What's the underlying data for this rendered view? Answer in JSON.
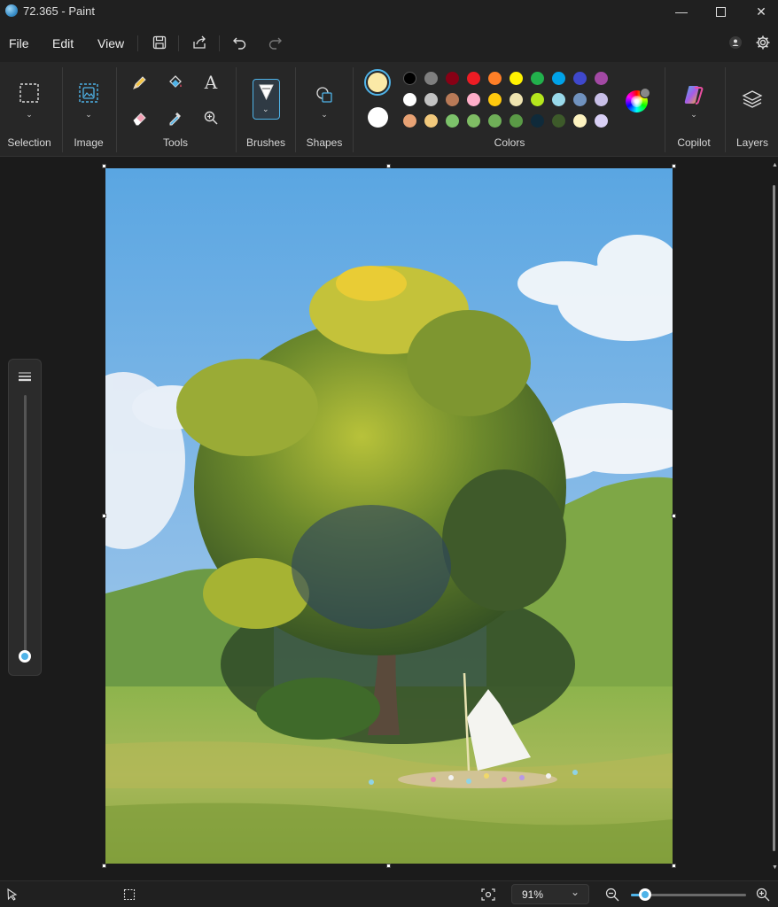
{
  "window": {
    "title": "72.365 - Paint"
  },
  "menu": {
    "file": "File",
    "edit": "Edit",
    "view": "View"
  },
  "ribbon": {
    "groups": {
      "selection": "Selection",
      "image": "Image",
      "tools": "Tools",
      "brushes": "Brushes",
      "shapes": "Shapes",
      "colors": "Colors",
      "copilot": "Copilot",
      "layers": "Layers"
    },
    "text_tool_glyph": "A"
  },
  "colors": {
    "primary": "#fbe9a7",
    "secondary": "#ffffff",
    "palette": [
      [
        "#000000",
        "#7f7f7f",
        "#880015",
        "#ed1c24",
        "#ff7f27",
        "#fff200",
        "#22b14c",
        "#00a2e8",
        "#3f48cc",
        "#a349a4"
      ],
      [
        "#ffffff",
        "#c3c3c3",
        "#b97a57",
        "#ffaec9",
        "#ffc90e",
        "#efe4b0",
        "#b5e61d",
        "#99d9ea",
        "#7092be",
        "#c8bfe7"
      ],
      [
        "#e8a274",
        "#f2c97c",
        "#7cc26a",
        "#7fbd64",
        "#6faf58",
        "#5a9a46",
        "#0f2a3a",
        "#3d5a2a",
        "#fdf3c0",
        "#d9d0f5"
      ]
    ]
  },
  "status": {
    "zoom": "91%",
    "zoom_slider_fraction": 0.12,
    "brush_size_fraction": 0.0
  }
}
